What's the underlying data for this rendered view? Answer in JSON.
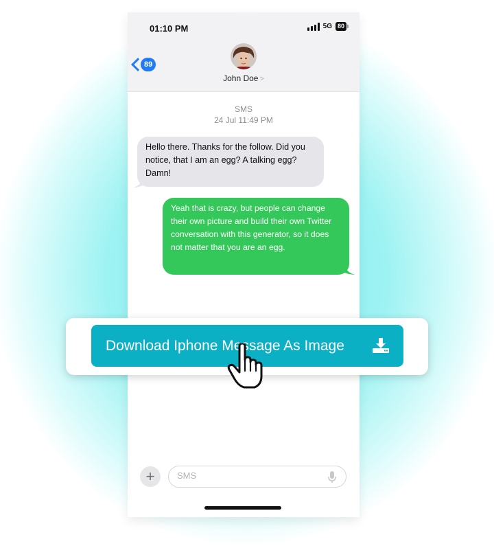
{
  "status_bar": {
    "time": "01:10 PM",
    "network": "5G",
    "battery": "80"
  },
  "header": {
    "back_count": "89",
    "contact_name": "John Doe",
    "contact_chevron": ">"
  },
  "thread": {
    "service": "SMS",
    "timestamp": "24 Jul 11:49 PM",
    "messages": [
      {
        "direction": "incoming",
        "text": "Hello there. Thanks for the follow. Did you notice, that I am an egg? A talking egg? Damn!"
      },
      {
        "direction": "outgoing",
        "text": "Yeah that is crazy, but people can change their own picture and build their own Twitter conversation with this generator, so it does not matter that you are an egg."
      }
    ]
  },
  "composer": {
    "placeholder": "SMS",
    "value": ""
  },
  "download": {
    "label": "Download Iphone Message As Image",
    "icon": "download-tray-icon"
  },
  "icons": {
    "add": "plus-icon",
    "mic": "microphone-icon",
    "cursor": "pointer-hand-icon",
    "back": "chevron-left-icon"
  },
  "colors": {
    "accent_blue": "#1f7cf5",
    "outgoing_bubble": "#34c759",
    "incoming_bubble": "#e5e5ea",
    "download_button": "#0cb0c4"
  }
}
